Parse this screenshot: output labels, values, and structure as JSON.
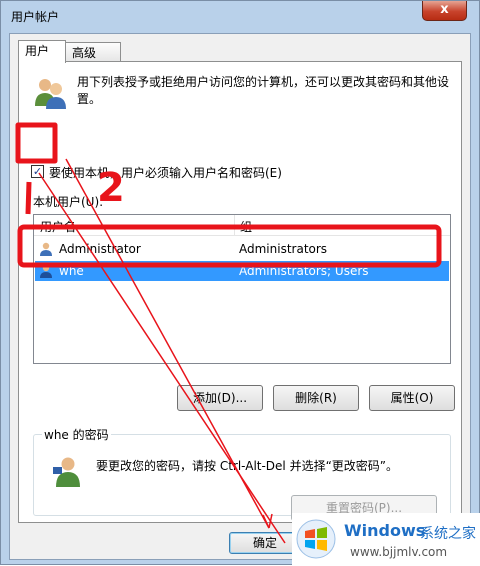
{
  "window": {
    "title": "用户帐户",
    "close_glyph": "x"
  },
  "tabs": [
    {
      "label": "用户",
      "active": true
    },
    {
      "label": "高级",
      "active": false
    }
  ],
  "intro_text": "用下列表授予或拒绝用户访问您的计算机，还可以更改其密码和其他设置。",
  "require_password": {
    "label": "要使用本机，用户必须输入用户名和密码(E)",
    "checked": true,
    "check_glyph": "✓"
  },
  "local_users": {
    "label": "本机用户(U):",
    "columns": [
      "用户名",
      "组"
    ],
    "rows": [
      {
        "name": "Administrator",
        "group": "Administrators",
        "selected": false
      },
      {
        "name": "whe",
        "group": "Administrators; Users",
        "selected": true
      }
    ]
  },
  "buttons": {
    "add": "添加(D)...",
    "remove": "删除(R)",
    "properties": "属性(O)"
  },
  "password_group": {
    "title": "whe 的密码",
    "text": "要更改您的密码，请按 Ctrl-Alt-Del 并选择“更改密码”。",
    "reset_button": "重置密码(P)..."
  },
  "footer": {
    "ok": "确定"
  },
  "watermark": {
    "brand": "Windows",
    "brand_cn": "系统之家",
    "url": "www.bjjmlv.com"
  },
  "annotation": {
    "label": "2",
    "color": "#e8141b"
  }
}
